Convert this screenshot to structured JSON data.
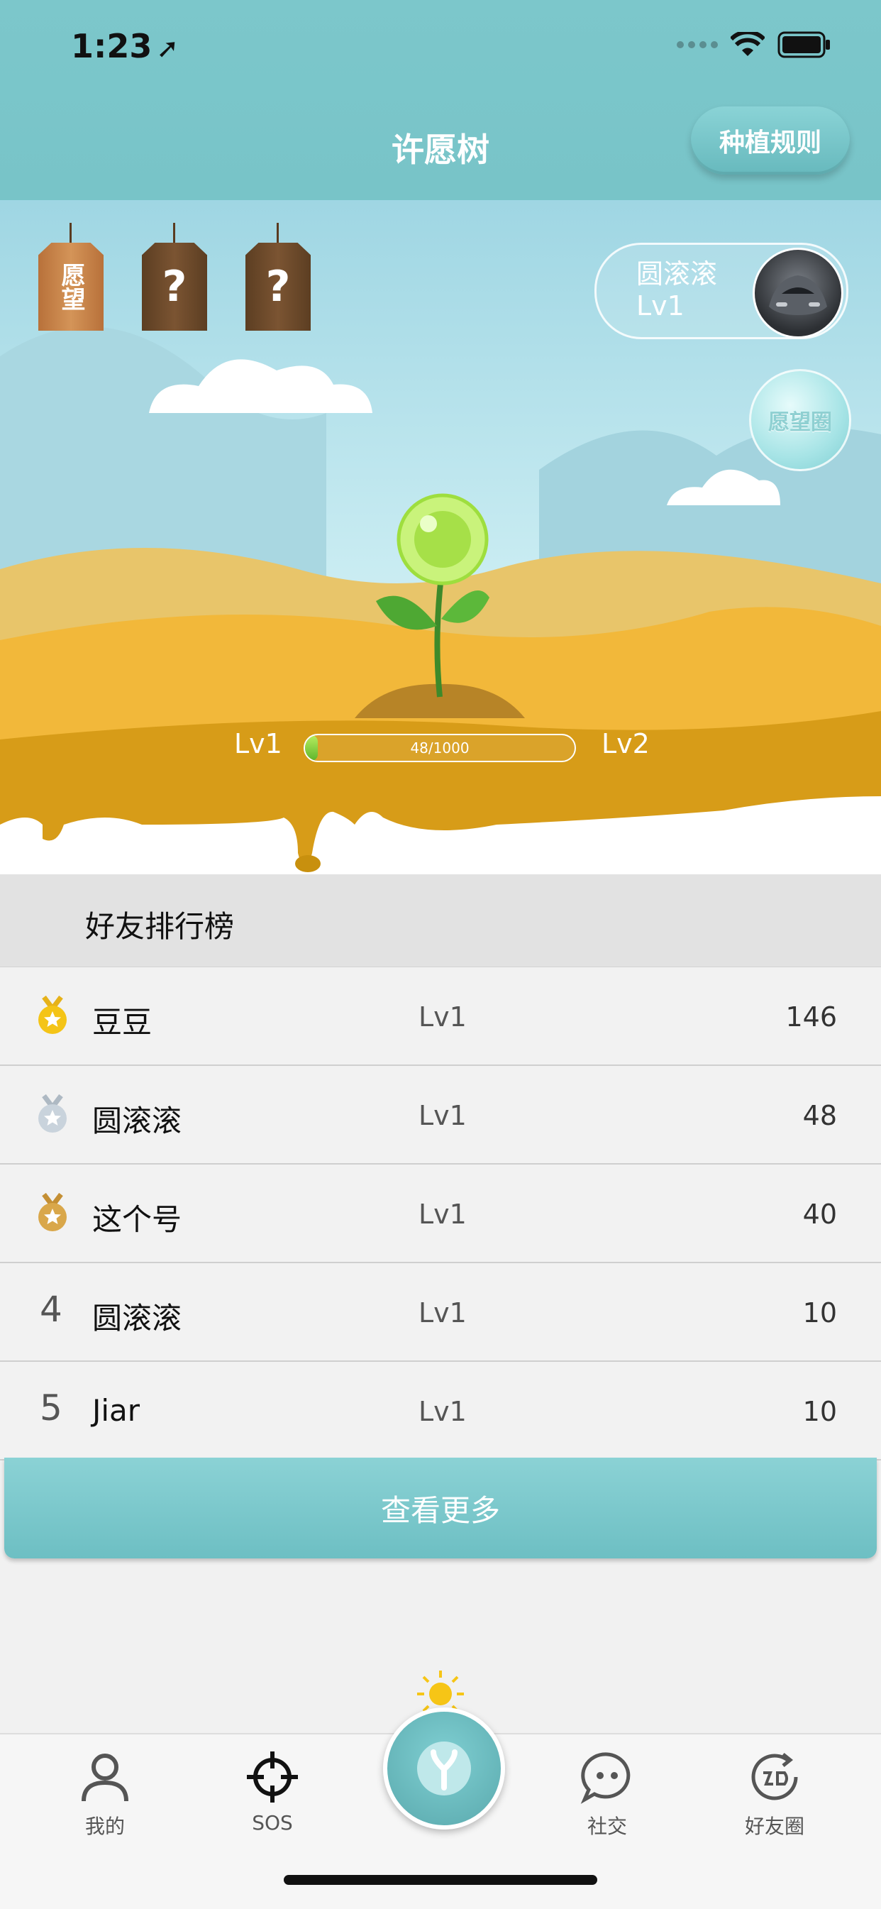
{
  "status_bar": {
    "time": "1:23",
    "location_arrow": "location-arrow-icon"
  },
  "header": {
    "title": "许愿树",
    "rules_button": "种植规则"
  },
  "scene": {
    "wish_tags": [
      {
        "label": "愿望",
        "state": "unlocked"
      },
      {
        "label": "?",
        "state": "locked"
      },
      {
        "label": "?",
        "state": "locked"
      }
    ],
    "user": {
      "name": "圆滚滚",
      "level": "Lv1"
    },
    "wish_circle_button": "愿望圈",
    "progress": {
      "current_level": "Lv1",
      "next_level": "Lv2",
      "text": "48/1000",
      "value": 48,
      "max": 1000
    }
  },
  "ranking": {
    "title": "好友排行榜",
    "rows": [
      {
        "rank": "1",
        "medal": "gold",
        "name": "豆豆",
        "level": "Lv1",
        "score": "146"
      },
      {
        "rank": "2",
        "medal": "silver",
        "name": "圆滚滚",
        "level": "Lv1",
        "score": "48"
      },
      {
        "rank": "3",
        "medal": "bronze",
        "name": "这个号",
        "level": "Lv1",
        "score": "40"
      },
      {
        "rank": "4",
        "medal": "",
        "name": "圆滚滚",
        "level": "Lv1",
        "score": "10"
      },
      {
        "rank": "5",
        "medal": "",
        "name": "Jiar",
        "level": "Lv1",
        "score": "10"
      }
    ],
    "more_button": "查看更多"
  },
  "tabbar": {
    "items": [
      {
        "label": "我的",
        "icon": "person-icon"
      },
      {
        "label": "SOS",
        "icon": "crosshair-icon"
      },
      {
        "label": "",
        "icon": "sprout-icon"
      },
      {
        "label": "社交",
        "icon": "chat-bubble-icon"
      },
      {
        "label": "好友圈",
        "icon": "friends-circle-icon"
      }
    ]
  },
  "colors": {
    "header_teal": "#7cc7cb",
    "button_teal": "#6dbfc3",
    "sand": "#f2b83a",
    "gold": "#f4c417",
    "silver": "#c9d3dc",
    "bronze": "#d9a74a"
  }
}
